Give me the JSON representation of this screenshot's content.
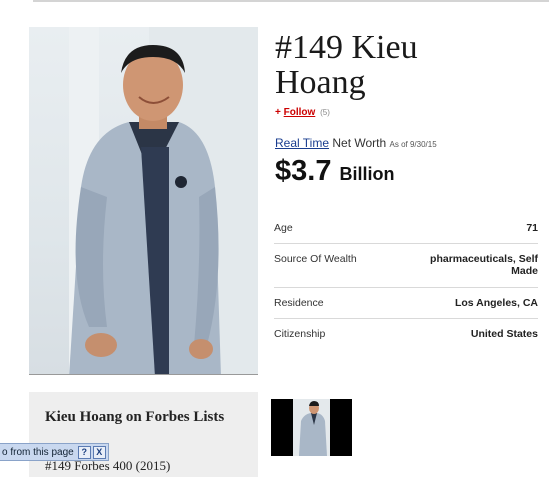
{
  "profile": {
    "name_line1": "#149 Kieu",
    "name_line2": "Hoang",
    "follow_label": "Follow",
    "follow_count": "(5)",
    "realtime_label": "Real Time",
    "networth_label": "Net Worth",
    "as_of": "As of 9/30/15",
    "worth_value": "$3.7",
    "worth_unit": "Billion"
  },
  "facts": [
    {
      "label": "Age",
      "value": "71"
    },
    {
      "label": "Source Of Wealth",
      "value": "pharmaceuticals, Self Made"
    },
    {
      "label": "Residence",
      "value": "Los Angeles, CA"
    },
    {
      "label": "Citizenship",
      "value": "United States"
    }
  ],
  "lists": {
    "title": "Kieu Hoang on Forbes Lists",
    "item": "#149 Forbes 400 (2015)"
  },
  "popup": {
    "text": "o from this page",
    "help_icon": "question-icon",
    "close_icon": "close-icon",
    "help_glyph": "?",
    "close_glyph": "X"
  },
  "colors": {
    "follow": "#cc0000",
    "link": "#1a3d8f",
    "panel": "#eeeeee"
  }
}
